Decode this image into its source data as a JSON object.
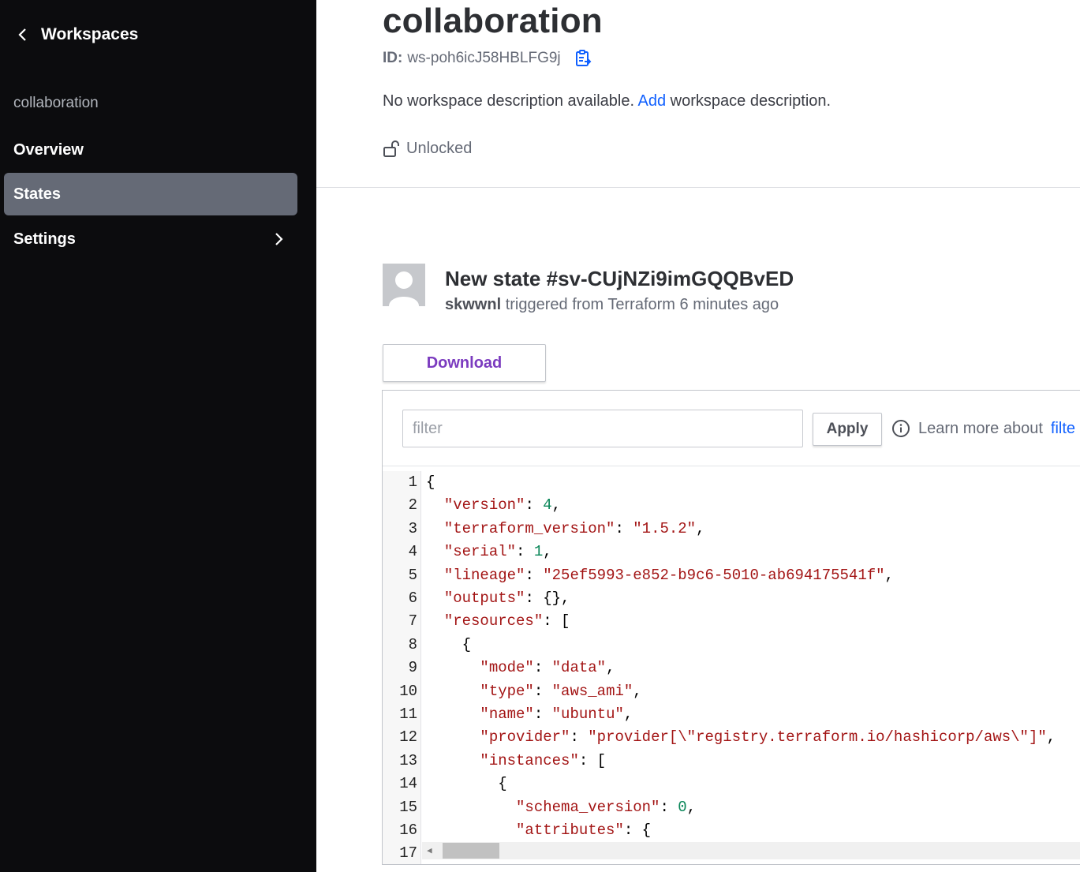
{
  "sidebar": {
    "back_label": "Workspaces",
    "workspace_name": "collaboration",
    "nav": [
      {
        "label": "Overview",
        "active": false
      },
      {
        "label": "States",
        "active": true
      },
      {
        "label": "Settings",
        "active": false,
        "has_chevron": true
      }
    ]
  },
  "workspace": {
    "title": "collaboration",
    "id_label": "ID:",
    "id_value": "ws-poh6icJ58HBLFG9j",
    "desc_prefix": "No workspace description available.",
    "desc_link": "Add",
    "desc_suffix": "workspace description.",
    "lock_status": "Unlocked"
  },
  "state": {
    "title": "New state #sv-CUjNZi9imGQQBvED",
    "user": "skwwnl",
    "trigger_text": "triggered from Terraform 6 minutes ago",
    "download_label": "Download"
  },
  "filter": {
    "placeholder": "filter",
    "apply_label": "Apply",
    "learn_prefix": "Learn more about",
    "learn_link": "filte"
  },
  "colors": {
    "sidebar_bg": "#0c0c0e",
    "active_nav_bg": "#656a76",
    "link_blue": "#1060ff",
    "download_purple": "#7b3bbf"
  },
  "code_lines": [
    {
      "n": "1",
      "html": "{"
    },
    {
      "n": "2",
      "html": "  <span class=\"k\">\"version\"</span>: <span class=\"n\">4</span>,"
    },
    {
      "n": "3",
      "html": "  <span class=\"k\">\"terraform_version\"</span>: <span class=\"s\">\"1.5.2\"</span>,"
    },
    {
      "n": "4",
      "html": "  <span class=\"k\">\"serial\"</span>: <span class=\"n\">1</span>,"
    },
    {
      "n": "5",
      "html": "  <span class=\"k\">\"lineage\"</span>: <span class=\"s\">\"25ef5993-e852-b9c6-5010-ab694175541f\"</span>,"
    },
    {
      "n": "6",
      "html": "  <span class=\"k\">\"outputs\"</span>: {},"
    },
    {
      "n": "7",
      "html": "  <span class=\"k\">\"resources\"</span>: ["
    },
    {
      "n": "8",
      "html": "    {"
    },
    {
      "n": "9",
      "html": "      <span class=\"k\">\"mode\"</span>: <span class=\"s\">\"data\"</span>,"
    },
    {
      "n": "10",
      "html": "      <span class=\"k\">\"type\"</span>: <span class=\"s\">\"aws_ami\"</span>,"
    },
    {
      "n": "11",
      "html": "      <span class=\"k\">\"name\"</span>: <span class=\"s\">\"ubuntu\"</span>,"
    },
    {
      "n": "12",
      "html": "      <span class=\"k\">\"provider\"</span>: <span class=\"s\">\"provider[\\\"registry.terraform.io/hashicorp/aws\\\"]\"</span>,"
    },
    {
      "n": "13",
      "html": "      <span class=\"k\">\"instances\"</span>: ["
    },
    {
      "n": "14",
      "html": "        {"
    },
    {
      "n": "15",
      "html": "          <span class=\"k\">\"schema_version\"</span>: <span class=\"n\">0</span>,"
    },
    {
      "n": "16",
      "html": "          <span class=\"k\">\"attributes\"</span>: {"
    },
    {
      "n": "17",
      "html": ""
    }
  ]
}
